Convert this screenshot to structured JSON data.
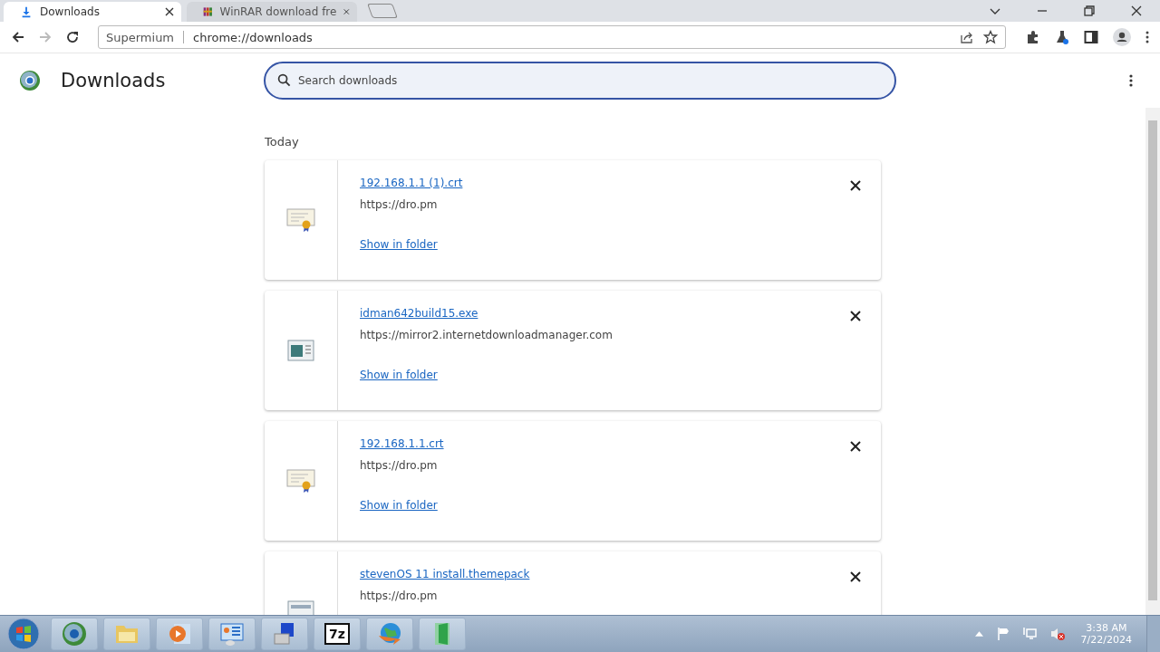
{
  "tabs": [
    {
      "title": "Downloads",
      "selected": true,
      "kind": "download"
    },
    {
      "title": "WinRAR download fre",
      "selected": false,
      "kind": "archive"
    }
  ],
  "address_bar": {
    "site_label": "Supermium",
    "url": "chrome://downloads"
  },
  "page": {
    "title": "Downloads",
    "search": {
      "placeholder": "Search downloads"
    },
    "section": "Today"
  },
  "downloads": [
    {
      "file_name": "192.168.1.1 (1).crt",
      "source": "https://dro.pm",
      "action": "Show in folder",
      "kind": "certificate"
    },
    {
      "file_name": "idman642build15.exe",
      "source": "https://mirror2.internetdownloadmanager.com",
      "action": "Show in folder",
      "kind": "program"
    },
    {
      "file_name": "192.168.1.1.crt",
      "source": "https://dro.pm",
      "action": "Show in folder",
      "kind": "certificate"
    },
    {
      "file_name": "stevenOS 11 install.themepack",
      "source": "https://dro.pm",
      "kind": "file"
    }
  ],
  "taskbar": {
    "items": [
      {
        "kind": "browser"
      },
      {
        "kind": "folder"
      },
      {
        "kind": "media"
      },
      {
        "kind": "control-panel"
      },
      {
        "kind": "computer"
      },
      {
        "kind": "archiver",
        "label": "7z"
      },
      {
        "kind": "globe"
      },
      {
        "kind": "door"
      }
    ],
    "clock": {
      "time": "3:38 AM",
      "date": "7/22/2024"
    }
  }
}
